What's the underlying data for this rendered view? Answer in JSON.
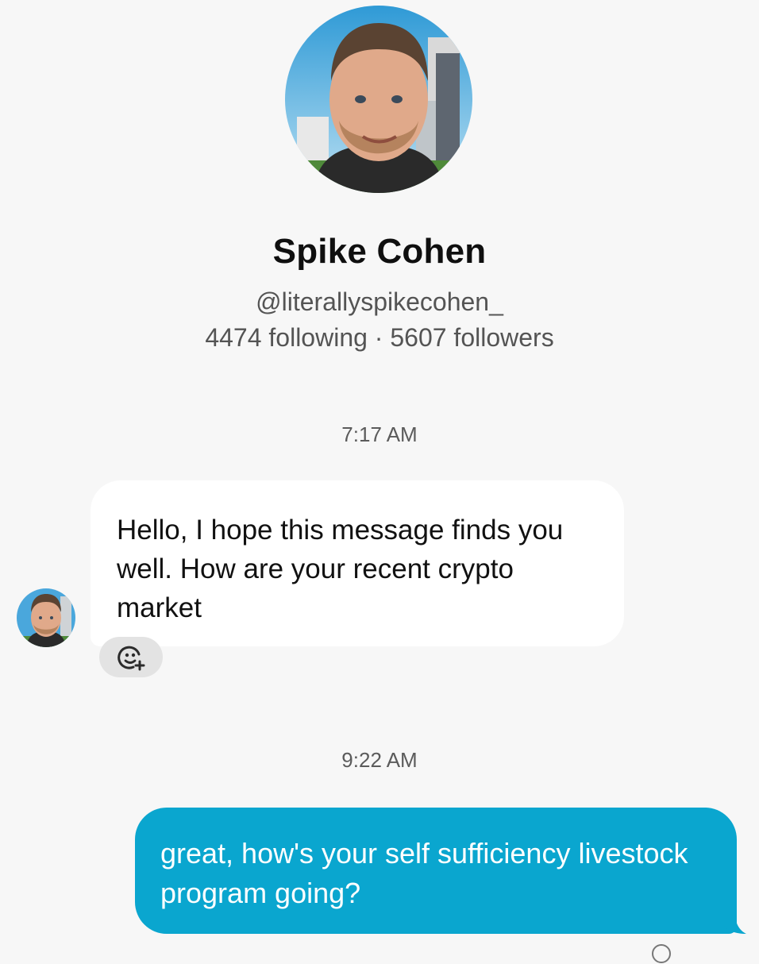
{
  "profile": {
    "name": "Spike Cohen",
    "handle": "@literallyspikecohen_",
    "stats": "4474 following · 5607 followers",
    "avatar_icon": "profile-photo"
  },
  "conversation": {
    "messages": [
      {
        "timestamp": "7:17 AM",
        "direction": "incoming",
        "text": "Hello, I hope this message finds you well. How are your recent crypto market"
      },
      {
        "timestamp": "9:22 AM",
        "direction": "outgoing",
        "text": "great, how's your self sufficiency livestock program going?"
      }
    ]
  },
  "colors": {
    "background": "#f7f7f7",
    "outgoing_bubble": "#0aa6cf",
    "incoming_bubble": "#ffffff",
    "reaction_button": "#e3e3e3"
  },
  "icons": {
    "reaction": "add-reaction-icon",
    "seen": "seen-status-icon"
  }
}
